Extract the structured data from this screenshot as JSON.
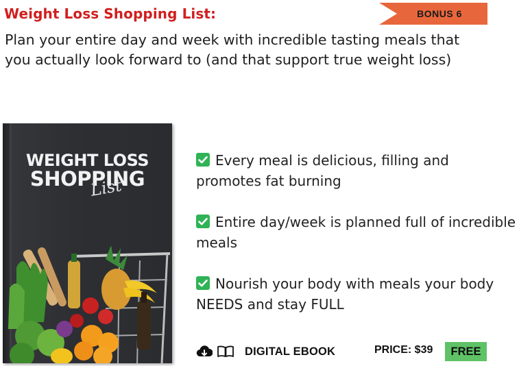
{
  "header": {
    "title": "Weight Loss Shopping List:",
    "badge": "BONUS 6",
    "intro": "Plan your entire day and week with incredible tasting meals that you actually look forward to (and that support true weight loss)"
  },
  "book": {
    "title_line_1": "WEIGHT LOSS",
    "title_line_2": "SHOPPING",
    "title_script": "List"
  },
  "features": [
    {
      "icon": "check-box-icon",
      "text": "Every meal is delicious, filling and promotes fat burning"
    },
    {
      "icon": "check-box-icon",
      "text": "Entire day/week is planned full of incredible meals"
    },
    {
      "icon": "check-box-icon",
      "text": "Nourish your body with meals your body NEEDS and stay FULL"
    }
  ],
  "footer": {
    "icons": [
      "cloud-download-icon",
      "open-book-icon"
    ],
    "format_label": "DIGITAL EBOOK",
    "price_label": "PRICE: $39",
    "free_label": "FREE"
  },
  "colors": {
    "title": "#d01f1f",
    "badge": "#e8663b",
    "check": "#2fb356",
    "free": "#5fc266",
    "cover": "#2d2f33"
  }
}
